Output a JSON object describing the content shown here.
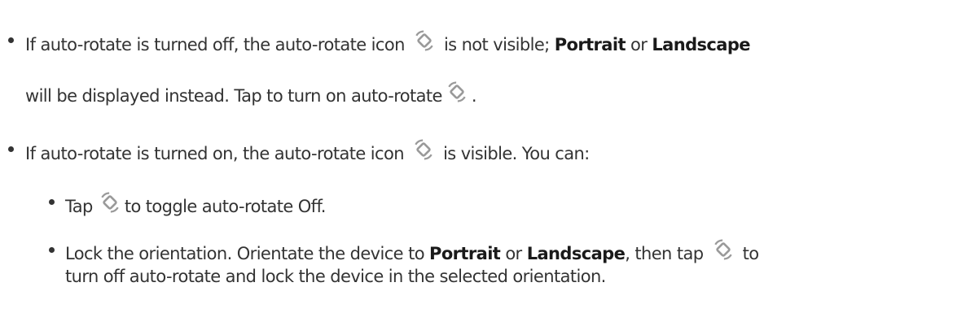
{
  "icon": "auto-rotate-icon",
  "colors": {
    "text": "#333333",
    "icon": "#9a9a9a"
  },
  "bullet1": {
    "part1": "If auto-rotate is turned off, the auto-rotate icon",
    "part2": "is not visible;",
    "portrait": "Portrait",
    "or": "or",
    "landscape": "Landscape",
    "line2_part1": "will be displayed instead. Tap to turn on auto-rotate",
    "line2_part2": "."
  },
  "bullet2": {
    "part1": "If auto-rotate is turned on, the auto-rotate icon",
    "part2": "is visible. You can:"
  },
  "sub1": {
    "part1": "Tap",
    "part2": "to toggle auto-rotate Off."
  },
  "sub2": {
    "part1": "Lock the orientation. Orientate the device to",
    "portrait": "Portrait",
    "or": "or",
    "landscape": "Landscape",
    "part2": ", then tap",
    "part3": "to",
    "line2": "turn off auto-rotate and lock the device in the selected orientation."
  }
}
